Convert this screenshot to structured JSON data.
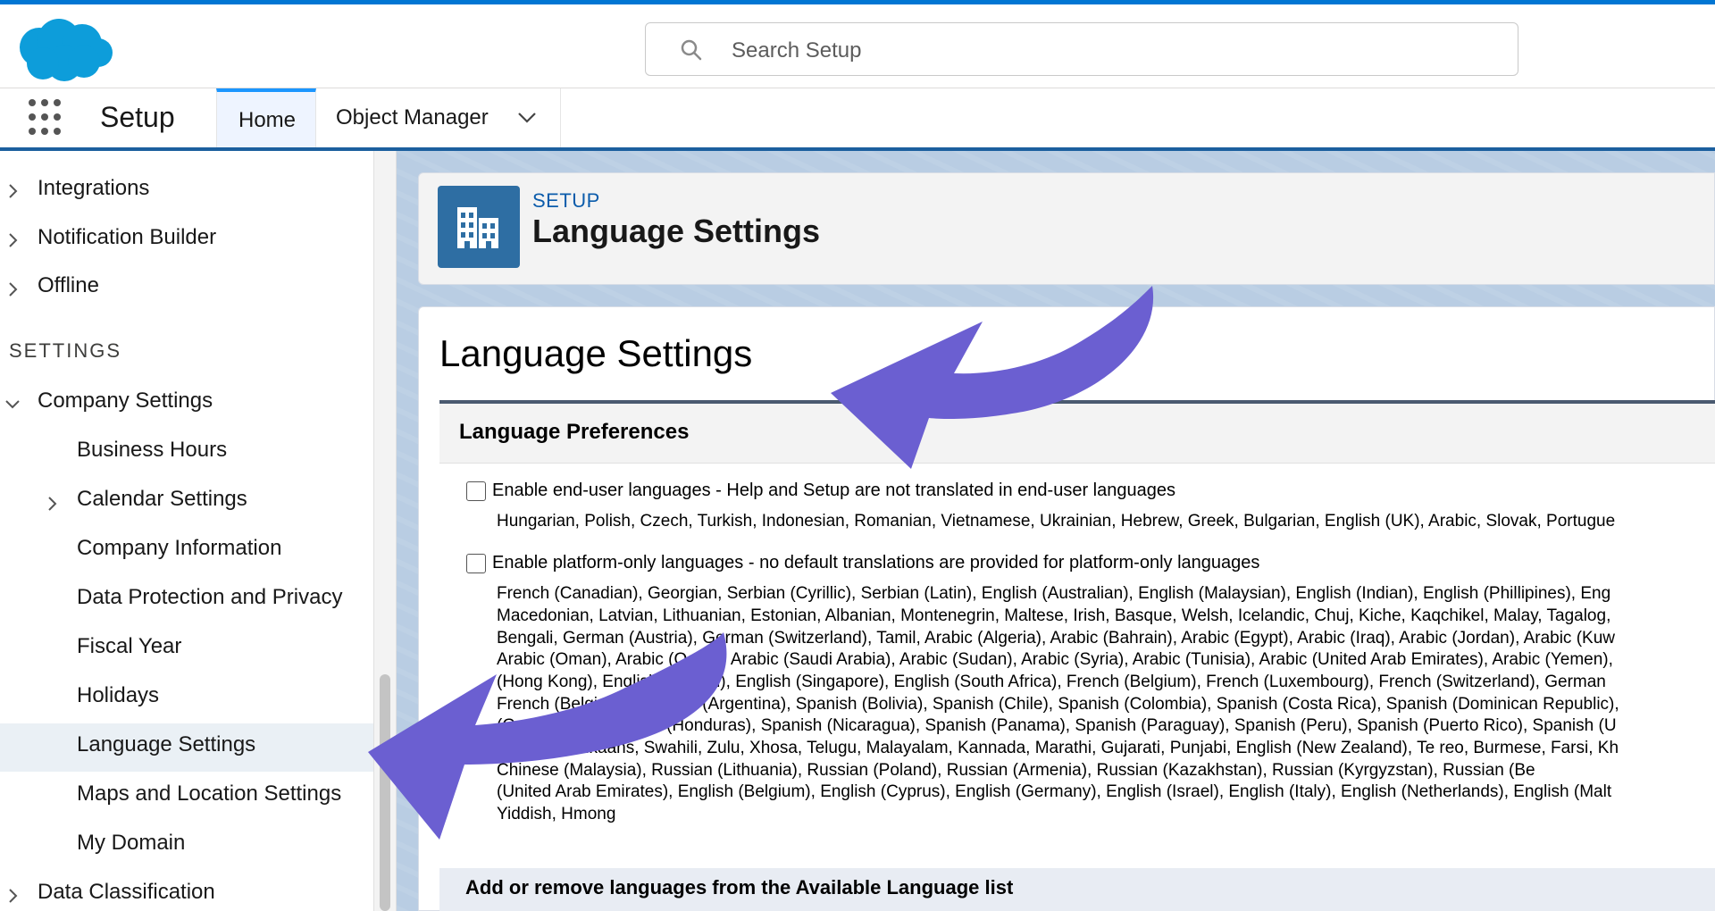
{
  "header": {
    "search_placeholder": "Search Setup"
  },
  "nav": {
    "app_name": "Setup",
    "tabs": [
      {
        "label": "Home"
      },
      {
        "label": "Object Manager"
      }
    ]
  },
  "sidebar": {
    "top_items": [
      {
        "label": "Integrations"
      },
      {
        "label": "Notification Builder"
      },
      {
        "label": "Offline"
      }
    ],
    "section_title": "SETTINGS",
    "company_settings": "Company Settings",
    "sub_items": [
      {
        "label": "Business Hours"
      },
      {
        "label": "Calendar Settings"
      },
      {
        "label": "Company Information"
      },
      {
        "label": "Data Protection and Privacy"
      },
      {
        "label": "Fiscal Year"
      },
      {
        "label": "Holidays"
      },
      {
        "label": "Language Settings"
      },
      {
        "label": "Maps and Location Settings"
      },
      {
        "label": "My Domain"
      }
    ],
    "bottom_item": "Data Classification"
  },
  "page_header": {
    "eyebrow": "SETUP",
    "title": "Language Settings"
  },
  "main": {
    "title": "Language Settings",
    "section_title": "Language Preferences",
    "option1_label": "Enable end-user languages - Help and Setup are not translated in end-user languages",
    "option1_languages": "Hungarian, Polish, Czech, Turkish, Indonesian, Romanian, Vietnamese, Ukrainian, Hebrew, Greek, Bulgarian, English (UK), Arabic, Slovak, Portugue",
    "option2_label": "Enable platform-only languages - no default translations are provided for platform-only languages",
    "option2_languages": [
      "French (Canadian), Georgian, Serbian (Cyrillic), Serbian (Latin), English (Australian), English (Malaysian), English (Indian), English (Phillipines), Eng",
      "Macedonian, Latvian, Lithuanian, Estonian, Albanian, Montenegrin, Maltese, Irish, Basque, Welsh, Icelandic, Chuj, Kiche, Kaqchikel, Malay, Tagalog,",
      "Bengali, German (Austria), German (Switzerland), Tamil, Arabic (Algeria), Arabic (Bahrain), Arabic (Egypt), Arabic (Iraq), Arabic (Jordan), Arabic (Kuw",
      "Arabic (Oman), Arabic (Qatar), Arabic (Saudi Arabia), Arabic (Sudan), Arabic (Syria), Arabic (Tunisia), Arabic (United Arab Emirates), Arabic (Yemen),",
      "(Hong Kong), English (Ireland), English (Singapore), English (South Africa), French (Belgium), French (Luxembourg), French (Switzerland), German",
      "French (Belgium), Spanish (Argentina), Spanish (Bolivia), Spanish (Chile), Spanish (Colombia), Spanish (Costa Rica), Spanish (Dominican Republic),",
      "(Guatemala), Spanish (Honduras), Spanish (Nicaragua), Spanish (Panama), Spanish (Paraguay), Spanish (Peru), Spanish (Puerto Rico), Spanish (U",
      "Catalan, Afrikaans, Swahili, Zulu, Xhosa, Telugu, Malayalam, Kannada, Marathi, Gujarati, Punjabi, English (New Zealand), Te reo, Burmese, Farsi, Kh",
      "Chinese (Malaysia), Russian (Lithuania), Russian (Poland), Russian (Armenia), Russian (Kazakhstan), Russian (Kyrgyzstan), Russian (Be",
      "(United Arab Emirates), English (Belgium), English (Cyprus), English (Germany), English (Israel), English (Italy), English (Netherlands), English (Malt",
      "Yiddish, Hmong"
    ],
    "add_remove_title": "Add or remove languages from the Available Language list"
  }
}
